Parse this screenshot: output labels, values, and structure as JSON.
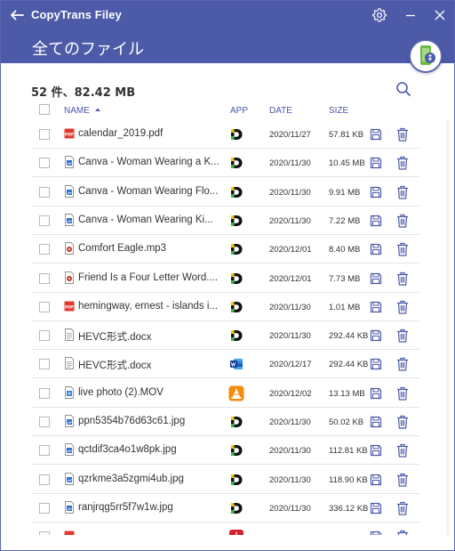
{
  "window": {
    "title": "CopyTrans Filey",
    "page_title": "全てのファイル",
    "accent": "#4c5aa8"
  },
  "summary": "52 件、82.42 MB",
  "columns": {
    "name": "NAME",
    "app": "APP",
    "date": "DATE",
    "size": "SIZE"
  },
  "files": [
    {
      "name": "calendar_2019.pdf",
      "type": "pdf",
      "app": "documents",
      "date": "2020/11/27",
      "size": "57.81 KB"
    },
    {
      "name": "Canva - Woman Wearing a K...",
      "type": "image",
      "app": "documents",
      "date": "2020/11/30",
      "size": "10.45 MB"
    },
    {
      "name": "Canva - Woman Wearing Flo...",
      "type": "image",
      "app": "documents",
      "date": "2020/11/30",
      "size": "9.91 MB"
    },
    {
      "name": "Canva - Woman Wearing Ki...",
      "type": "image",
      "app": "documents",
      "date": "2020/11/30",
      "size": "7.22 MB"
    },
    {
      "name": "Comfort Eagle.mp3",
      "type": "audio",
      "app": "documents",
      "date": "2020/12/01",
      "size": "8.40 MB"
    },
    {
      "name": "Friend Is a Four Letter Word....",
      "type": "audio",
      "app": "documents",
      "date": "2020/12/01",
      "size": "7.73 MB"
    },
    {
      "name": "hemingway, ernest - islands i...",
      "type": "pdf",
      "app": "documents",
      "date": "2020/11/30",
      "size": "1.01 MB"
    },
    {
      "name": "HEVC形式.docx",
      "type": "doc",
      "app": "documents",
      "date": "2020/11/30",
      "size": "292.44 KB"
    },
    {
      "name": "HEVC形式.docx",
      "type": "doc",
      "app": "word",
      "date": "2020/12/17",
      "size": "292.44 KB"
    },
    {
      "name": "live photo (2).MOV",
      "type": "video",
      "app": "vlc",
      "date": "2020/12/02",
      "size": "13.13 MB"
    },
    {
      "name": "ppn5354b76d63c61.jpg",
      "type": "image",
      "app": "documents",
      "date": "2020/11/30",
      "size": "50.02 KB"
    },
    {
      "name": "qctdif3ca4o1w8pk.jpg",
      "type": "image",
      "app": "documents",
      "date": "2020/11/30",
      "size": "112.81 KB"
    },
    {
      "name": "qzrkme3a5zgmi4ub.jpg",
      "type": "image",
      "app": "documents",
      "date": "2020/11/30",
      "size": "118.90 KB"
    },
    {
      "name": "ranjrqg5rr5f7w1w.jpg",
      "type": "image",
      "app": "documents",
      "date": "2020/11/30",
      "size": "336.12 KB"
    },
    {
      "name": "",
      "type": "pdf",
      "app": "acrobat",
      "date": "",
      "size": ""
    }
  ]
}
